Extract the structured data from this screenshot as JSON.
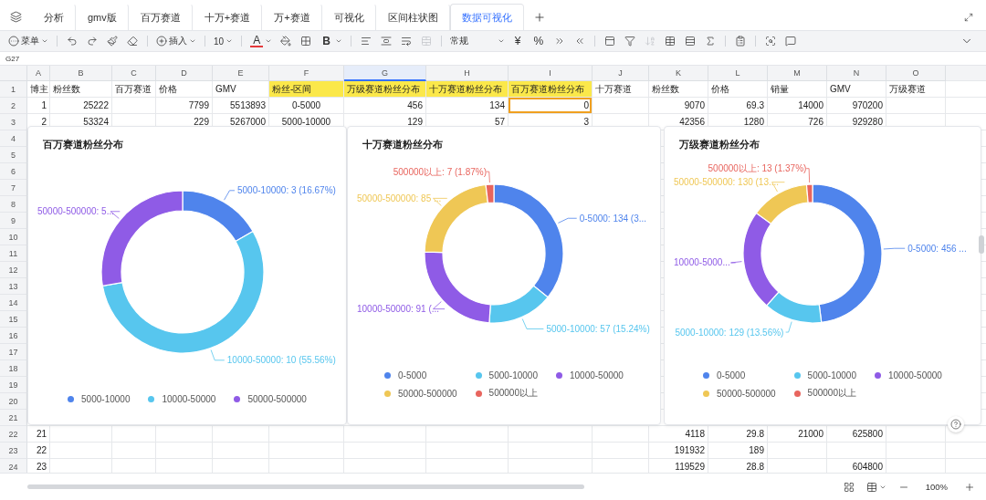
{
  "tabs": [
    {
      "label": "分析",
      "selected": false
    },
    {
      "label": "gmv版",
      "selected": false
    },
    {
      "label": "百万赛道",
      "selected": false
    },
    {
      "label": "十万+赛道",
      "selected": false
    },
    {
      "label": "万+赛道",
      "selected": false
    },
    {
      "label": "可视化",
      "selected": false
    },
    {
      "label": "区间柱状图",
      "selected": false
    },
    {
      "label": "数据可视化",
      "selected": true
    }
  ],
  "toolbar": {
    "menu_label": "菜单",
    "insert_label": "插入",
    "font_size": "10",
    "text_color_glyph": "A",
    "bold_glyph": "B",
    "number_format": "常规",
    "currency_glyph": "¥",
    "percent_glyph": "%",
    "merge_disabled": true,
    "sort_disabled": true
  },
  "name_box": "G27",
  "columns": [
    {
      "label": "A",
      "selected": false
    },
    {
      "label": "B",
      "selected": false
    },
    {
      "label": "C",
      "selected": false
    },
    {
      "label": "D",
      "selected": false
    },
    {
      "label": "E",
      "selected": false
    },
    {
      "label": "F",
      "selected": false
    },
    {
      "label": "G",
      "selected": true
    },
    {
      "label": "H",
      "selected": false
    },
    {
      "label": "I",
      "selected": false
    },
    {
      "label": "J",
      "selected": false
    },
    {
      "label": "K",
      "selected": false
    },
    {
      "label": "L",
      "selected": false
    },
    {
      "label": "M",
      "selected": false
    },
    {
      "label": "N",
      "selected": false
    },
    {
      "label": "O",
      "selected": false
    }
  ],
  "rows": [
    {
      "label": "1",
      "cells": [
        "博主",
        "粉丝数",
        "百万赛道",
        "价格",
        "GMV",
        {
          "text": "粉丝-区间",
          "highlight": true
        },
        {
          "text": "万级赛道粉丝分布",
          "highlight": true
        },
        {
          "text": "十万赛道粉丝分布",
          "highlight": true
        },
        {
          "text": "百万赛道粉丝分布",
          "highlight": true
        },
        "十万赛道",
        "粉丝数",
        "价格",
        "销量",
        "GMV",
        "万级赛道"
      ]
    },
    {
      "label": "2",
      "cells": [
        "1",
        "25222",
        null,
        "7799",
        "5513893",
        "0-5000",
        "456",
        "134",
        {
          "text": "0",
          "selected": true
        },
        null,
        "9070",
        "69.3",
        "14000",
        "970200",
        null
      ]
    },
    {
      "label": "3",
      "cells": [
        "2",
        "53324",
        null,
        "229",
        "5267000",
        "5000-10000",
        "129",
        "57",
        "3",
        null,
        "42356",
        "1280",
        "726",
        "929280",
        null
      ]
    },
    {
      "label": "4"
    },
    {
      "label": "5"
    },
    {
      "label": "6"
    },
    {
      "label": "7"
    },
    {
      "label": "8"
    },
    {
      "label": "9"
    },
    {
      "label": "10"
    },
    {
      "label": "11"
    },
    {
      "label": "12"
    },
    {
      "label": "13"
    },
    {
      "label": "14"
    },
    {
      "label": "15"
    },
    {
      "label": "16"
    },
    {
      "label": "17"
    },
    {
      "label": "18"
    },
    {
      "label": "19"
    },
    {
      "label": "20"
    },
    {
      "label": "21"
    },
    {
      "label": "22",
      "cells": [
        "21",
        null,
        null,
        null,
        null,
        null,
        null,
        null,
        null,
        null,
        "4118",
        "29.8",
        "21000",
        "625800",
        null
      ]
    },
    {
      "label": "23",
      "cells": [
        "22",
        null,
        null,
        null,
        null,
        null,
        null,
        null,
        null,
        null,
        "191932",
        "189",
        null,
        null,
        null
      ]
    },
    {
      "label": "24",
      "cells": [
        "23",
        null,
        null,
        null,
        null,
        null,
        null,
        null,
        null,
        null,
        "119529",
        "28.8",
        null,
        "604800",
        null
      ]
    }
  ],
  "charts": [
    {
      "callouts": [
        "5000-10000: 3 (16.67%)",
        "50000-500000: 5...",
        "10000-50000: 10 (55.56%)"
      ],
      "chart_data": {
        "type": "donut",
        "title": "百万赛道粉丝分布",
        "categories": [
          "5000-10000",
          "10000-50000",
          "50000-500000"
        ],
        "values": [
          16.67,
          55.56,
          27.77
        ],
        "colors": [
          "#4f84ec",
          "#57c6ee",
          "#8f5be6"
        ],
        "legend": "bottom"
      }
    },
    {
      "callouts": [
        "500000以上: 7 (1.87%)",
        "50000-500000: 85 ...",
        "0-5000: 134 (3...",
        "10000-50000: 91 (...",
        "5000-10000: 57 (15.24%)"
      ],
      "chart_data": {
        "type": "donut",
        "title": "十万赛道粉丝分布",
        "categories": [
          "0-5000",
          "5000-10000",
          "10000-50000",
          "50000-500000",
          "500000以上"
        ],
        "values": [
          35.83,
          15.24,
          24.33,
          22.73,
          1.87
        ],
        "colors": [
          "#4f84ec",
          "#57c6ee",
          "#8f5be6",
          "#efc755",
          "#e8655e"
        ],
        "legend": "bottom"
      }
    },
    {
      "callouts": [
        "500000以上: 13 (1.37%)",
        "50000-500000: 130 (13....",
        "0-5000: 456 ...",
        "10000-5000...",
        "5000-10000: 129 (13.56%)"
      ],
      "chart_data": {
        "type": "donut",
        "title": "万级赛道粉丝分布",
        "categories": [
          "0-5000",
          "5000-10000",
          "10000-50000",
          "50000-500000",
          "500000以上"
        ],
        "values": [
          47.95,
          13.56,
          23.45,
          13.67,
          1.37
        ],
        "colors": [
          "#4f84ec",
          "#57c6ee",
          "#8f5be6",
          "#efc755",
          "#e8655e"
        ],
        "legend": "bottom"
      }
    }
  ],
  "status_bar": {
    "zoom": "100%"
  }
}
